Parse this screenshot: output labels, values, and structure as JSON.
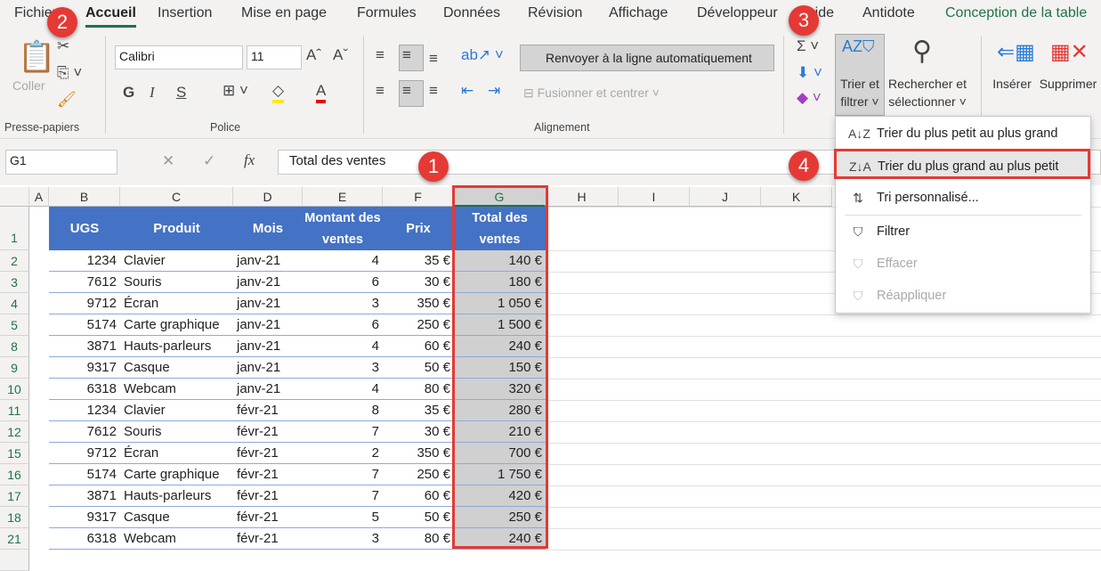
{
  "tabs": [
    "Fichier",
    "Accueil",
    "Insertion",
    "Mise en page",
    "Formules",
    "Données",
    "Révision",
    "Affichage",
    "Développeur",
    "Aide",
    "Antidote",
    "Conception de la table"
  ],
  "ribbon": {
    "paste": "Coller",
    "clipboard_group": "Presse-papiers",
    "font_name": "Calibri",
    "font_size": "11",
    "bold": "G",
    "italic": "I",
    "underline": "S",
    "font_group": "Police",
    "wrap": "Renvoyer à la ligne automatiquement",
    "merge": "Fusionner et centrer",
    "align_group": "Alignement",
    "sort_filter": [
      "Trier et",
      "filtrer ˅"
    ],
    "find_select": [
      "Rechercher et",
      "sélectionner ˅"
    ],
    "insert": "Insérer",
    "delete": "Supprimer"
  },
  "formula_bar": {
    "name_box": "G1",
    "fx": "fx",
    "value": "Total des ventes"
  },
  "columns": [
    "A",
    "B",
    "C",
    "D",
    "E",
    "F",
    "G",
    "H",
    "I",
    "J",
    "K"
  ],
  "table": {
    "headers": [
      "UGS",
      "Produit",
      "Mois",
      "Montant des ventes",
      "Prix",
      "Total des ventes"
    ],
    "rows": [
      [
        "2",
        "1234",
        "Clavier",
        "janv-21",
        "4",
        "35 €",
        "140 €"
      ],
      [
        "3",
        "7612",
        "Souris",
        "janv-21",
        "6",
        "30 €",
        "180 €"
      ],
      [
        "4",
        "9712",
        "Écran",
        "janv-21",
        "3",
        "350 €",
        "1 050 €"
      ],
      [
        "5",
        "5174",
        "Carte graphique",
        "janv-21",
        "6",
        "250 €",
        "1 500 €"
      ],
      [
        "8",
        "3871",
        "Hauts-parleurs",
        "janv-21",
        "4",
        "60 €",
        "240 €"
      ],
      [
        "9",
        "9317",
        "Casque",
        "janv-21",
        "3",
        "50 €",
        "150 €"
      ],
      [
        "10",
        "6318",
        "Webcam",
        "janv-21",
        "4",
        "80 €",
        "320 €"
      ],
      [
        "11",
        "1234",
        "Clavier",
        "févr-21",
        "8",
        "35 €",
        "280 €"
      ],
      [
        "12",
        "7612",
        "Souris",
        "févr-21",
        "7",
        "30 €",
        "210 €"
      ],
      [
        "15",
        "9712",
        "Écran",
        "févr-21",
        "2",
        "350 €",
        "700 €"
      ],
      [
        "16",
        "5174",
        "Carte graphique",
        "févr-21",
        "7",
        "250 €",
        "1 750 €"
      ],
      [
        "17",
        "3871",
        "Hauts-parleurs",
        "févr-21",
        "7",
        "60 €",
        "420 €"
      ],
      [
        "18",
        "9317",
        "Casque",
        "févr-21",
        "5",
        "50 €",
        "250 €"
      ],
      [
        "21",
        "6318",
        "Webcam",
        "févr-21",
        "3",
        "80 €",
        "240 €"
      ]
    ]
  },
  "header_row": "1",
  "menu": [
    {
      "label": "Trier du plus petit au plus grand",
      "icon": "sort-asc-icon",
      "glyph": "A↓Z"
    },
    {
      "label": "Trier du plus grand au plus petit",
      "icon": "sort-desc-icon",
      "glyph": "Z↓A"
    },
    {
      "label": "Tri personnalisé...",
      "icon": "custom-sort-icon",
      "glyph": "⇅"
    },
    {
      "label": "Filtrer",
      "icon": "filter-icon",
      "glyph": "⛉"
    },
    {
      "label": "Effacer",
      "icon": "clear-filter-icon",
      "glyph": "⛉"
    },
    {
      "label": "Réappliquer",
      "icon": "reapply-icon",
      "glyph": "⛉"
    }
  ],
  "badges": [
    "1",
    "2",
    "3",
    "4"
  ],
  "colors": {
    "accent": "#217346",
    "table_header": "#4472c4",
    "highlight": "#e53935",
    "selection": "#d0d0d0"
  }
}
